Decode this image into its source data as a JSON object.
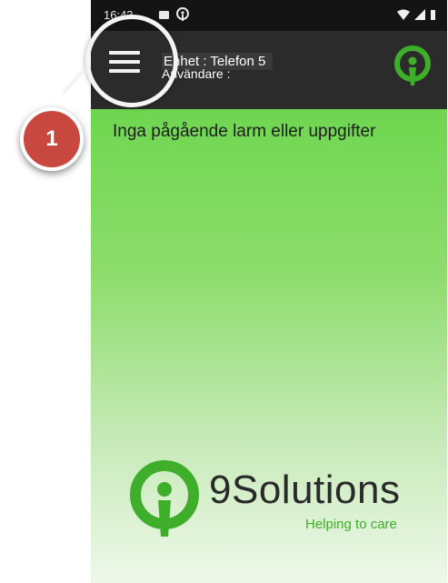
{
  "status_bar": {
    "time": "16:43"
  },
  "app_bar": {
    "unit_label": "Enhet : Telefon 5",
    "user_label": "Användare :"
  },
  "content": {
    "empty_message": "Inga pågående larm eller uppgifter"
  },
  "brand": {
    "name": "9Solutions",
    "tagline": "Helping to care",
    "color": "#3fae2a"
  },
  "callout": {
    "number": "1",
    "color": "#c8473e"
  },
  "icons": [
    "menu-icon",
    "wifi-icon",
    "signal-icon",
    "battery-icon",
    "brand-logo-icon"
  ]
}
